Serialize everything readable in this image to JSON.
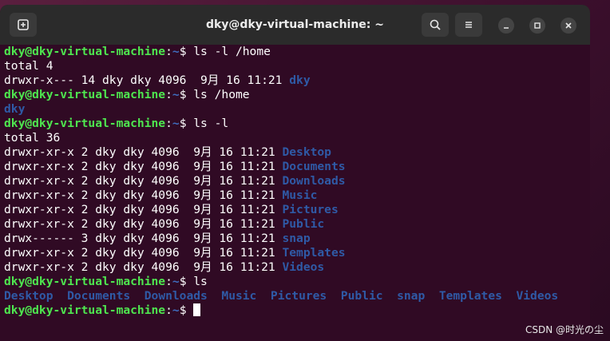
{
  "window": {
    "title": "dky@dky-virtual-machine: ~"
  },
  "prompt": {
    "user": "dky@dky-virtual-machine",
    "sep": ":",
    "path": "~",
    "dollar": "$ "
  },
  "lines": [
    {
      "type": "cmd",
      "cmd": "ls -l /home"
    },
    {
      "type": "text",
      "text": "total 4"
    },
    {
      "type": "entry",
      "perm": "drwxr-x--- 14 dky dky 4096  9月 16 11:21 ",
      "name": "dky"
    },
    {
      "type": "cmd",
      "cmd": "ls /home"
    },
    {
      "type": "dirs",
      "items": [
        "dky"
      ]
    },
    {
      "type": "cmd",
      "cmd": "ls -l"
    },
    {
      "type": "text",
      "text": "total 36"
    },
    {
      "type": "entry",
      "perm": "drwxr-xr-x 2 dky dky 4096  9月 16 11:21 ",
      "name": "Desktop"
    },
    {
      "type": "entry",
      "perm": "drwxr-xr-x 2 dky dky 4096  9月 16 11:21 ",
      "name": "Documents"
    },
    {
      "type": "entry",
      "perm": "drwxr-xr-x 2 dky dky 4096  9月 16 11:21 ",
      "name": "Downloads"
    },
    {
      "type": "entry",
      "perm": "drwxr-xr-x 2 dky dky 4096  9月 16 11:21 ",
      "name": "Music"
    },
    {
      "type": "entry",
      "perm": "drwxr-xr-x 2 dky dky 4096  9月 16 11:21 ",
      "name": "Pictures"
    },
    {
      "type": "entry",
      "perm": "drwxr-xr-x 2 dky dky 4096  9月 16 11:21 ",
      "name": "Public"
    },
    {
      "type": "entry",
      "perm": "drwx------ 3 dky dky 4096  9月 16 11:21 ",
      "name": "snap"
    },
    {
      "type": "entry",
      "perm": "drwxr-xr-x 2 dky dky 4096  9月 16 11:21 ",
      "name": "Templates"
    },
    {
      "type": "entry",
      "perm": "drwxr-xr-x 2 dky dky 4096  9月 16 11:21 ",
      "name": "Videos"
    },
    {
      "type": "cmd",
      "cmd": "ls"
    },
    {
      "type": "dirs",
      "items": [
        "Desktop",
        "Documents",
        "Downloads",
        "Music",
        "Pictures",
        "Public",
        "snap",
        "Templates",
        "Videos"
      ]
    },
    {
      "type": "cmd",
      "cmd": "",
      "cursor": true
    }
  ],
  "watermark": "CSDN @时光の尘",
  "colors": {
    "background": "#300a24",
    "prompt_user": "#4ee64f",
    "prompt_path": "#3f6ec0",
    "directory": "#2f5aa6"
  },
  "icons": {
    "new_tab": "new-tab-icon",
    "search": "search-icon",
    "menu": "hamburger-menu-icon",
    "minimize": "minimize-icon",
    "maximize": "maximize-icon",
    "close": "close-icon"
  }
}
